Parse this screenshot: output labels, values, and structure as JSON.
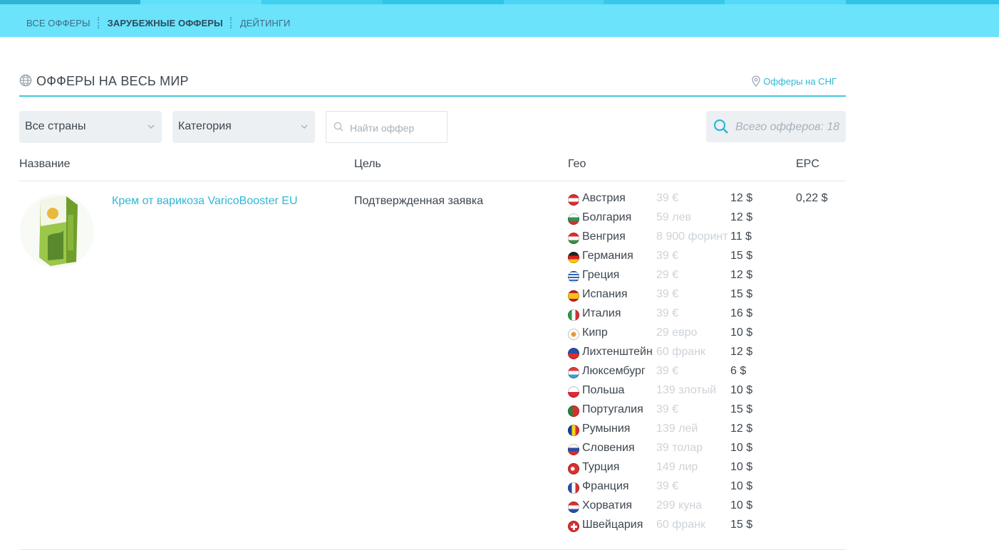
{
  "nav": {
    "items": [
      {
        "label": "Все офферы",
        "active": false
      },
      {
        "label": "Зарубежные офферы",
        "active": true
      },
      {
        "label": "Дейтинги",
        "active": false
      }
    ]
  },
  "header": {
    "title": "ОФФЕРЫ НА ВЕСЬ МИР",
    "cis_link": "Офферы на СНГ"
  },
  "filters": {
    "country_select": "Все страны",
    "category_select": "Категория",
    "search_placeholder": "Найти оффер",
    "total": "Всего офферов: 18"
  },
  "table": {
    "columns": [
      "Название",
      "Цель",
      "Гео",
      "EPC"
    ],
    "rows": [
      {
        "name": "Крем от варикоза VaricoBooster EU",
        "goal": "Подтвержденная заявка",
        "epc": "0,22 $",
        "geo": [
          {
            "country": "Австрия",
            "price": "39 €",
            "payout": "12 $",
            "flag": "austria"
          },
          {
            "country": "Болгария",
            "price": "59 лев",
            "payout": "12 $",
            "flag": "bulgaria"
          },
          {
            "country": "Венгрия",
            "price": "8 900 форинт",
            "payout": "11 $",
            "flag": "hungary"
          },
          {
            "country": "Германия",
            "price": "39 €",
            "payout": "15 $",
            "flag": "germany"
          },
          {
            "country": "Греция",
            "price": "29 €",
            "payout": "12 $",
            "flag": "greece"
          },
          {
            "country": "Испания",
            "price": "39 €",
            "payout": "15 $",
            "flag": "spain"
          },
          {
            "country": "Италия",
            "price": "39 €",
            "payout": "16 $",
            "flag": "italy"
          },
          {
            "country": "Кипр",
            "price": "29 евро",
            "payout": "10 $",
            "flag": "cyprus"
          },
          {
            "country": "Лихтенштейн",
            "price": "60 франк",
            "payout": "12 $",
            "flag": "liechtenstein"
          },
          {
            "country": "Люксембург",
            "price": "39 €",
            "payout": "6 $",
            "flag": "luxembourg"
          },
          {
            "country": "Польша",
            "price": "139 злотый",
            "payout": "10 $",
            "flag": "poland"
          },
          {
            "country": "Португалия",
            "price": "39 €",
            "payout": "15 $",
            "flag": "portugal"
          },
          {
            "country": "Румыния",
            "price": "139 лей",
            "payout": "12 $",
            "flag": "romania"
          },
          {
            "country": "Словения",
            "price": "39 толар",
            "payout": "10 $",
            "flag": "slovenia"
          },
          {
            "country": "Турция",
            "price": "149 лир",
            "payout": "10 $",
            "flag": "turkey"
          },
          {
            "country": "Франция",
            "price": "39 €",
            "payout": "10 $",
            "flag": "france"
          },
          {
            "country": "Хорватия",
            "price": "299 куна",
            "payout": "10 $",
            "flag": "croatia"
          },
          {
            "country": "Швейцария",
            "price": "60 франк",
            "payout": "15 $",
            "flag": "switzerland"
          }
        ]
      }
    ]
  },
  "colors": {
    "nav_bg": "#6ae3fb",
    "accent": "#2fb7d6",
    "muted": "#cdd3d8",
    "panel": "#ecf0f3"
  }
}
